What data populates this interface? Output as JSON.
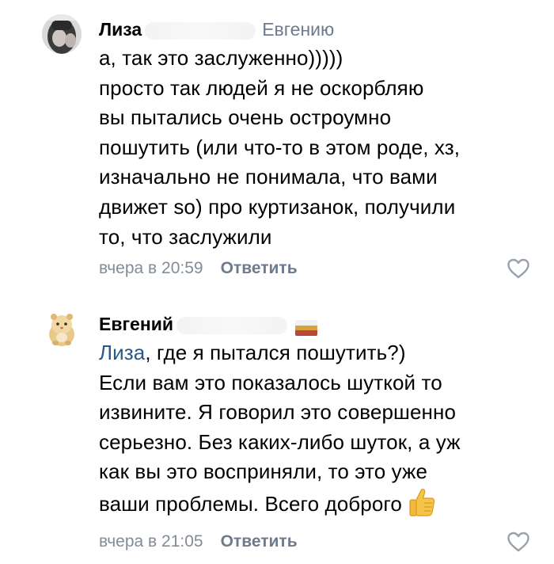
{
  "comments": [
    {
      "author": "Лиза",
      "author_visible_fragment": "р",
      "reply_to": "Евгению",
      "lines": [
        "а, так это заслуженно)))))",
        "просто так людей я не оскорбляю",
        "вы пытались очень остроумно",
        "пошутить (или что-то в этом роде, хз,",
        "изначально не понимала, что вами",
        "движет so) про куртизанок, получили",
        "то, что заслужили"
      ],
      "time": "вчера в 20:59",
      "reply_label": "Ответить",
      "avatar_icon": "user-photo-avatar",
      "like_icon": "heart-outline-icon"
    },
    {
      "author": "Евгений",
      "author_visible_fragment": "в",
      "mention": "Лиза",
      "first_line_rest": ", где я пытался пошутить?)",
      "lines": [
        "Если вам это показалось шуткой то",
        "извините. Я говорил это совершенно",
        "серьезно. Без каких-либо шуток, а уж",
        "как вы это восприняли, то это уже",
        "ваши проблемы. Всего доброго"
      ],
      "time": "вчера в 21:05",
      "reply_label": "Ответить",
      "avatar_icon": "hamster-avatar",
      "flag_icon": "flag-icon",
      "emoji_icon": "thumbs-up-emoji",
      "like_icon": "heart-outline-icon"
    }
  ],
  "colors": {
    "text": "#000000",
    "secondary": "#818c99",
    "reply_to": "#6d7b8c",
    "link": "#2a5885",
    "like_outline": "#99a2ad"
  }
}
